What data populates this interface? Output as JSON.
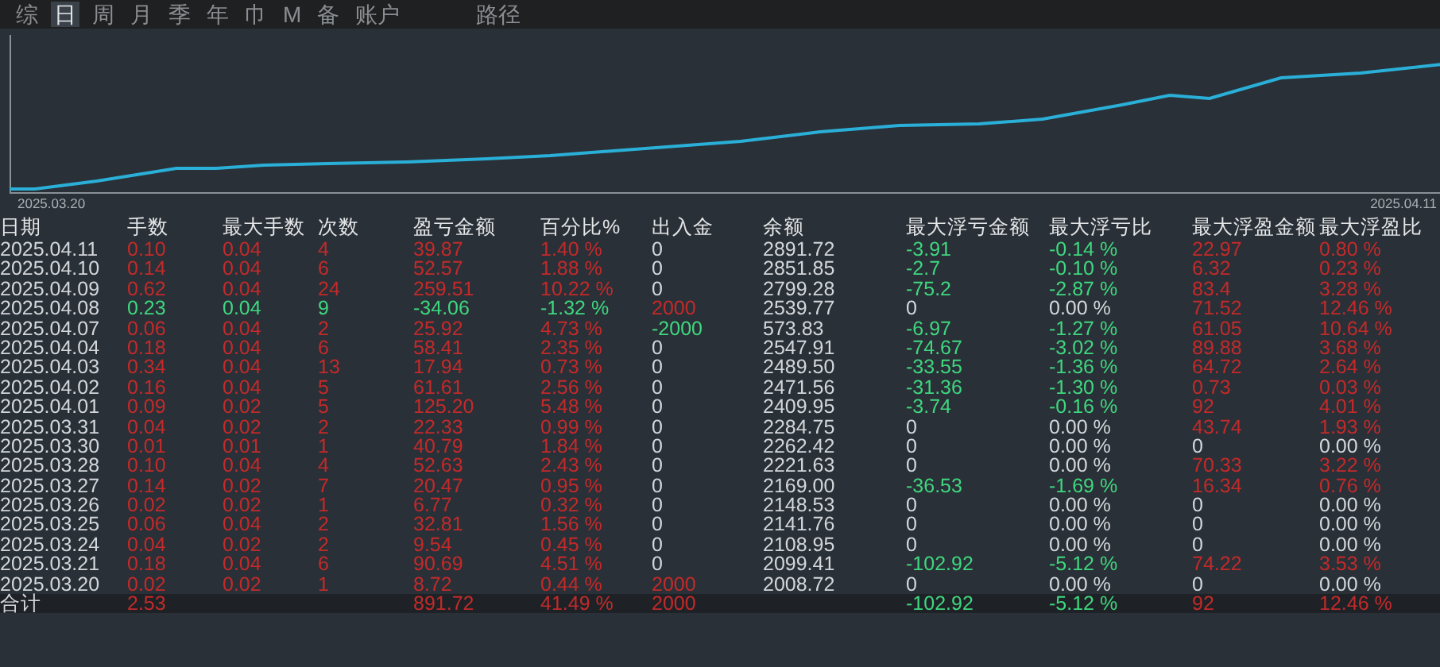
{
  "tabs": [
    {
      "label": "综",
      "selected": false
    },
    {
      "label": "日",
      "selected": true
    },
    {
      "label": "周",
      "selected": false
    },
    {
      "label": "月",
      "selected": false
    },
    {
      "label": "季",
      "selected": false
    },
    {
      "label": "年",
      "selected": false
    },
    {
      "label": "巾",
      "selected": false
    },
    {
      "label": "M",
      "selected": false
    },
    {
      "label": "备",
      "selected": false
    },
    {
      "label": "账户",
      "selected": false
    },
    {
      "label": "路径",
      "selected": false
    }
  ],
  "chart": {
    "start_label": "2025.03.20",
    "end_label": "2025.04.11"
  },
  "table": {
    "columns": [
      "日期",
      "手数",
      "最大手数",
      "次数",
      "盈亏金额",
      "百分比%",
      "出入金",
      "余额",
      "最大浮亏金额",
      "最大浮亏比",
      "最大浮盈金额",
      "最大浮盈比"
    ],
    "rows": [
      {
        "cells": [
          {
            "text": "2025.04.11",
            "kind": "flat"
          },
          {
            "text": "0.10",
            "kind": "up"
          },
          {
            "text": "0.04",
            "kind": "up"
          },
          {
            "text": "4",
            "kind": "up"
          },
          {
            "text": "39.87",
            "kind": "up"
          },
          {
            "text": "1.40 %",
            "kind": "up"
          },
          {
            "text": "0",
            "kind": "flat"
          },
          {
            "text": "2891.72",
            "kind": "flat"
          },
          {
            "text": "-3.91",
            "kind": "down"
          },
          {
            "text": "-0.14 %",
            "kind": "down"
          },
          {
            "text": "22.97",
            "kind": "up"
          },
          {
            "text": "0.80 %",
            "kind": "up"
          }
        ]
      },
      {
        "cells": [
          {
            "text": "2025.04.10",
            "kind": "flat"
          },
          {
            "text": "0.14",
            "kind": "up"
          },
          {
            "text": "0.04",
            "kind": "up"
          },
          {
            "text": "6",
            "kind": "up"
          },
          {
            "text": "52.57",
            "kind": "up"
          },
          {
            "text": "1.88 %",
            "kind": "up"
          },
          {
            "text": "0",
            "kind": "flat"
          },
          {
            "text": "2851.85",
            "kind": "flat"
          },
          {
            "text": "-2.7",
            "kind": "down"
          },
          {
            "text": "-0.10 %",
            "kind": "down"
          },
          {
            "text": "6.32",
            "kind": "up"
          },
          {
            "text": "0.23 %",
            "kind": "up"
          }
        ]
      },
      {
        "cells": [
          {
            "text": "2025.04.09",
            "kind": "flat"
          },
          {
            "text": "0.62",
            "kind": "up"
          },
          {
            "text": "0.04",
            "kind": "up"
          },
          {
            "text": "24",
            "kind": "up"
          },
          {
            "text": "259.51",
            "kind": "up"
          },
          {
            "text": "10.22 %",
            "kind": "up"
          },
          {
            "text": "0",
            "kind": "flat"
          },
          {
            "text": "2799.28",
            "kind": "flat"
          },
          {
            "text": "-75.2",
            "kind": "down"
          },
          {
            "text": "-2.87 %",
            "kind": "down"
          },
          {
            "text": "83.4",
            "kind": "up"
          },
          {
            "text": "3.28 %",
            "kind": "up"
          }
        ]
      },
      {
        "cells": [
          {
            "text": "2025.04.08",
            "kind": "flat"
          },
          {
            "text": "0.23",
            "kind": "down"
          },
          {
            "text": "0.04",
            "kind": "down"
          },
          {
            "text": "9",
            "kind": "down"
          },
          {
            "text": "-34.06",
            "kind": "down"
          },
          {
            "text": "-1.32 %",
            "kind": "down"
          },
          {
            "text": "2000",
            "kind": "up"
          },
          {
            "text": "2539.77",
            "kind": "flat"
          },
          {
            "text": "0",
            "kind": "flat"
          },
          {
            "text": "0.00 %",
            "kind": "flat"
          },
          {
            "text": "71.52",
            "kind": "up"
          },
          {
            "text": "12.46 %",
            "kind": "up"
          }
        ]
      },
      {
        "cells": [
          {
            "text": "2025.04.07",
            "kind": "flat"
          },
          {
            "text": "0.06",
            "kind": "up"
          },
          {
            "text": "0.04",
            "kind": "up"
          },
          {
            "text": "2",
            "kind": "up"
          },
          {
            "text": "25.92",
            "kind": "up"
          },
          {
            "text": "4.73 %",
            "kind": "up"
          },
          {
            "text": "-2000",
            "kind": "down"
          },
          {
            "text": "573.83",
            "kind": "flat"
          },
          {
            "text": "-6.97",
            "kind": "down"
          },
          {
            "text": "-1.27 %",
            "kind": "down"
          },
          {
            "text": "61.05",
            "kind": "up"
          },
          {
            "text": "10.64 %",
            "kind": "up"
          }
        ]
      },
      {
        "cells": [
          {
            "text": "2025.04.04",
            "kind": "flat"
          },
          {
            "text": "0.18",
            "kind": "up"
          },
          {
            "text": "0.04",
            "kind": "up"
          },
          {
            "text": "6",
            "kind": "up"
          },
          {
            "text": "58.41",
            "kind": "up"
          },
          {
            "text": "2.35 %",
            "kind": "up"
          },
          {
            "text": "0",
            "kind": "flat"
          },
          {
            "text": "2547.91",
            "kind": "flat"
          },
          {
            "text": "-74.67",
            "kind": "down"
          },
          {
            "text": "-3.02 %",
            "kind": "down"
          },
          {
            "text": "89.88",
            "kind": "up"
          },
          {
            "text": "3.68 %",
            "kind": "up"
          }
        ]
      },
      {
        "cells": [
          {
            "text": "2025.04.03",
            "kind": "flat"
          },
          {
            "text": "0.34",
            "kind": "up"
          },
          {
            "text": "0.04",
            "kind": "up"
          },
          {
            "text": "13",
            "kind": "up"
          },
          {
            "text": "17.94",
            "kind": "up"
          },
          {
            "text": "0.73 %",
            "kind": "up"
          },
          {
            "text": "0",
            "kind": "flat"
          },
          {
            "text": "2489.50",
            "kind": "flat"
          },
          {
            "text": "-33.55",
            "kind": "down"
          },
          {
            "text": "-1.36 %",
            "kind": "down"
          },
          {
            "text": "64.72",
            "kind": "up"
          },
          {
            "text": "2.64 %",
            "kind": "up"
          }
        ]
      },
      {
        "cells": [
          {
            "text": "2025.04.02",
            "kind": "flat"
          },
          {
            "text": "0.16",
            "kind": "up"
          },
          {
            "text": "0.04",
            "kind": "up"
          },
          {
            "text": "5",
            "kind": "up"
          },
          {
            "text": "61.61",
            "kind": "up"
          },
          {
            "text": "2.56 %",
            "kind": "up"
          },
          {
            "text": "0",
            "kind": "flat"
          },
          {
            "text": "2471.56",
            "kind": "flat"
          },
          {
            "text": "-31.36",
            "kind": "down"
          },
          {
            "text": "-1.30 %",
            "kind": "down"
          },
          {
            "text": "0.73",
            "kind": "up"
          },
          {
            "text": "0.03 %",
            "kind": "up"
          }
        ]
      },
      {
        "cells": [
          {
            "text": "2025.04.01",
            "kind": "flat"
          },
          {
            "text": "0.09",
            "kind": "up"
          },
          {
            "text": "0.02",
            "kind": "up"
          },
          {
            "text": "5",
            "kind": "up"
          },
          {
            "text": "125.20",
            "kind": "up"
          },
          {
            "text": "5.48 %",
            "kind": "up"
          },
          {
            "text": "0",
            "kind": "flat"
          },
          {
            "text": "2409.95",
            "kind": "flat"
          },
          {
            "text": "-3.74",
            "kind": "down"
          },
          {
            "text": "-0.16 %",
            "kind": "down"
          },
          {
            "text": "92",
            "kind": "up"
          },
          {
            "text": "4.01 %",
            "kind": "up"
          }
        ]
      },
      {
        "cells": [
          {
            "text": "2025.03.31",
            "kind": "flat"
          },
          {
            "text": "0.04",
            "kind": "up"
          },
          {
            "text": "0.02",
            "kind": "up"
          },
          {
            "text": "2",
            "kind": "up"
          },
          {
            "text": "22.33",
            "kind": "up"
          },
          {
            "text": "0.99 %",
            "kind": "up"
          },
          {
            "text": "0",
            "kind": "flat"
          },
          {
            "text": "2284.75",
            "kind": "flat"
          },
          {
            "text": "0",
            "kind": "flat"
          },
          {
            "text": "0.00 %",
            "kind": "flat"
          },
          {
            "text": "43.74",
            "kind": "up"
          },
          {
            "text": "1.93 %",
            "kind": "up"
          }
        ]
      },
      {
        "cells": [
          {
            "text": "2025.03.30",
            "kind": "flat"
          },
          {
            "text": "0.01",
            "kind": "up"
          },
          {
            "text": "0.01",
            "kind": "up"
          },
          {
            "text": "1",
            "kind": "up"
          },
          {
            "text": "40.79",
            "kind": "up"
          },
          {
            "text": "1.84 %",
            "kind": "up"
          },
          {
            "text": "0",
            "kind": "flat"
          },
          {
            "text": "2262.42",
            "kind": "flat"
          },
          {
            "text": "0",
            "kind": "flat"
          },
          {
            "text": "0.00 %",
            "kind": "flat"
          },
          {
            "text": "0",
            "kind": "flat"
          },
          {
            "text": "0.00 %",
            "kind": "flat"
          }
        ]
      },
      {
        "cells": [
          {
            "text": "2025.03.28",
            "kind": "flat"
          },
          {
            "text": "0.10",
            "kind": "up"
          },
          {
            "text": "0.04",
            "kind": "up"
          },
          {
            "text": "4",
            "kind": "up"
          },
          {
            "text": "52.63",
            "kind": "up"
          },
          {
            "text": "2.43 %",
            "kind": "up"
          },
          {
            "text": "0",
            "kind": "flat"
          },
          {
            "text": "2221.63",
            "kind": "flat"
          },
          {
            "text": "0",
            "kind": "flat"
          },
          {
            "text": "0.00 %",
            "kind": "flat"
          },
          {
            "text": "70.33",
            "kind": "up"
          },
          {
            "text": "3.22 %",
            "kind": "up"
          }
        ]
      },
      {
        "cells": [
          {
            "text": "2025.03.27",
            "kind": "flat"
          },
          {
            "text": "0.14",
            "kind": "up"
          },
          {
            "text": "0.02",
            "kind": "up"
          },
          {
            "text": "7",
            "kind": "up"
          },
          {
            "text": "20.47",
            "kind": "up"
          },
          {
            "text": "0.95 %",
            "kind": "up"
          },
          {
            "text": "0",
            "kind": "flat"
          },
          {
            "text": "2169.00",
            "kind": "flat"
          },
          {
            "text": "-36.53",
            "kind": "down"
          },
          {
            "text": "-1.69 %",
            "kind": "down"
          },
          {
            "text": "16.34",
            "kind": "up"
          },
          {
            "text": "0.76 %",
            "kind": "up"
          }
        ]
      },
      {
        "cells": [
          {
            "text": "2025.03.26",
            "kind": "flat"
          },
          {
            "text": "0.02",
            "kind": "up"
          },
          {
            "text": "0.02",
            "kind": "up"
          },
          {
            "text": "1",
            "kind": "up"
          },
          {
            "text": "6.77",
            "kind": "up"
          },
          {
            "text": "0.32 %",
            "kind": "up"
          },
          {
            "text": "0",
            "kind": "flat"
          },
          {
            "text": "2148.53",
            "kind": "flat"
          },
          {
            "text": "0",
            "kind": "flat"
          },
          {
            "text": "0.00 %",
            "kind": "flat"
          },
          {
            "text": "0",
            "kind": "flat"
          },
          {
            "text": "0.00 %",
            "kind": "flat"
          }
        ]
      },
      {
        "cells": [
          {
            "text": "2025.03.25",
            "kind": "flat"
          },
          {
            "text": "0.06",
            "kind": "up"
          },
          {
            "text": "0.04",
            "kind": "up"
          },
          {
            "text": "2",
            "kind": "up"
          },
          {
            "text": "32.81",
            "kind": "up"
          },
          {
            "text": "1.56 %",
            "kind": "up"
          },
          {
            "text": "0",
            "kind": "flat"
          },
          {
            "text": "2141.76",
            "kind": "flat"
          },
          {
            "text": "0",
            "kind": "flat"
          },
          {
            "text": "0.00 %",
            "kind": "flat"
          },
          {
            "text": "0",
            "kind": "flat"
          },
          {
            "text": "0.00 %",
            "kind": "flat"
          }
        ]
      },
      {
        "cells": [
          {
            "text": "2025.03.24",
            "kind": "flat"
          },
          {
            "text": "0.04",
            "kind": "up"
          },
          {
            "text": "0.02",
            "kind": "up"
          },
          {
            "text": "2",
            "kind": "up"
          },
          {
            "text": "9.54",
            "kind": "up"
          },
          {
            "text": "0.45 %",
            "kind": "up"
          },
          {
            "text": "0",
            "kind": "flat"
          },
          {
            "text": "2108.95",
            "kind": "flat"
          },
          {
            "text": "0",
            "kind": "flat"
          },
          {
            "text": "0.00 %",
            "kind": "flat"
          },
          {
            "text": "0",
            "kind": "flat"
          },
          {
            "text": "0.00 %",
            "kind": "flat"
          }
        ]
      },
      {
        "cells": [
          {
            "text": "2025.03.21",
            "kind": "flat"
          },
          {
            "text": "0.18",
            "kind": "up"
          },
          {
            "text": "0.04",
            "kind": "up"
          },
          {
            "text": "6",
            "kind": "up"
          },
          {
            "text": "90.69",
            "kind": "up"
          },
          {
            "text": "4.51 %",
            "kind": "up"
          },
          {
            "text": "0",
            "kind": "flat"
          },
          {
            "text": "2099.41",
            "kind": "flat"
          },
          {
            "text": "-102.92",
            "kind": "down"
          },
          {
            "text": "-5.12 %",
            "kind": "down"
          },
          {
            "text": "74.22",
            "kind": "up"
          },
          {
            "text": "3.53 %",
            "kind": "up"
          }
        ]
      },
      {
        "cells": [
          {
            "text": "2025.03.20",
            "kind": "flat"
          },
          {
            "text": "0.02",
            "kind": "up"
          },
          {
            "text": "0.02",
            "kind": "up"
          },
          {
            "text": "1",
            "kind": "up"
          },
          {
            "text": "8.72",
            "kind": "up"
          },
          {
            "text": "0.44 %",
            "kind": "up"
          },
          {
            "text": "2000",
            "kind": "up"
          },
          {
            "text": "2008.72",
            "kind": "flat"
          },
          {
            "text": "0",
            "kind": "flat"
          },
          {
            "text": "0.00 %",
            "kind": "flat"
          },
          {
            "text": "0",
            "kind": "flat"
          },
          {
            "text": "0.00 %",
            "kind": "flat"
          }
        ]
      }
    ],
    "total": {
      "cells": [
        {
          "text": "合计",
          "kind": "flat"
        },
        {
          "text": "2.53",
          "kind": "up"
        },
        null,
        null,
        {
          "text": "891.72",
          "kind": "up"
        },
        {
          "text": "41.49 %",
          "kind": "up"
        },
        {
          "text": "2000",
          "kind": "up"
        },
        null,
        {
          "text": "-102.92",
          "kind": "down"
        },
        {
          "text": "-5.12 %",
          "kind": "down"
        },
        {
          "text": "92",
          "kind": "up"
        },
        {
          "text": "12.46 %",
          "kind": "up"
        }
      ]
    }
  }
}
